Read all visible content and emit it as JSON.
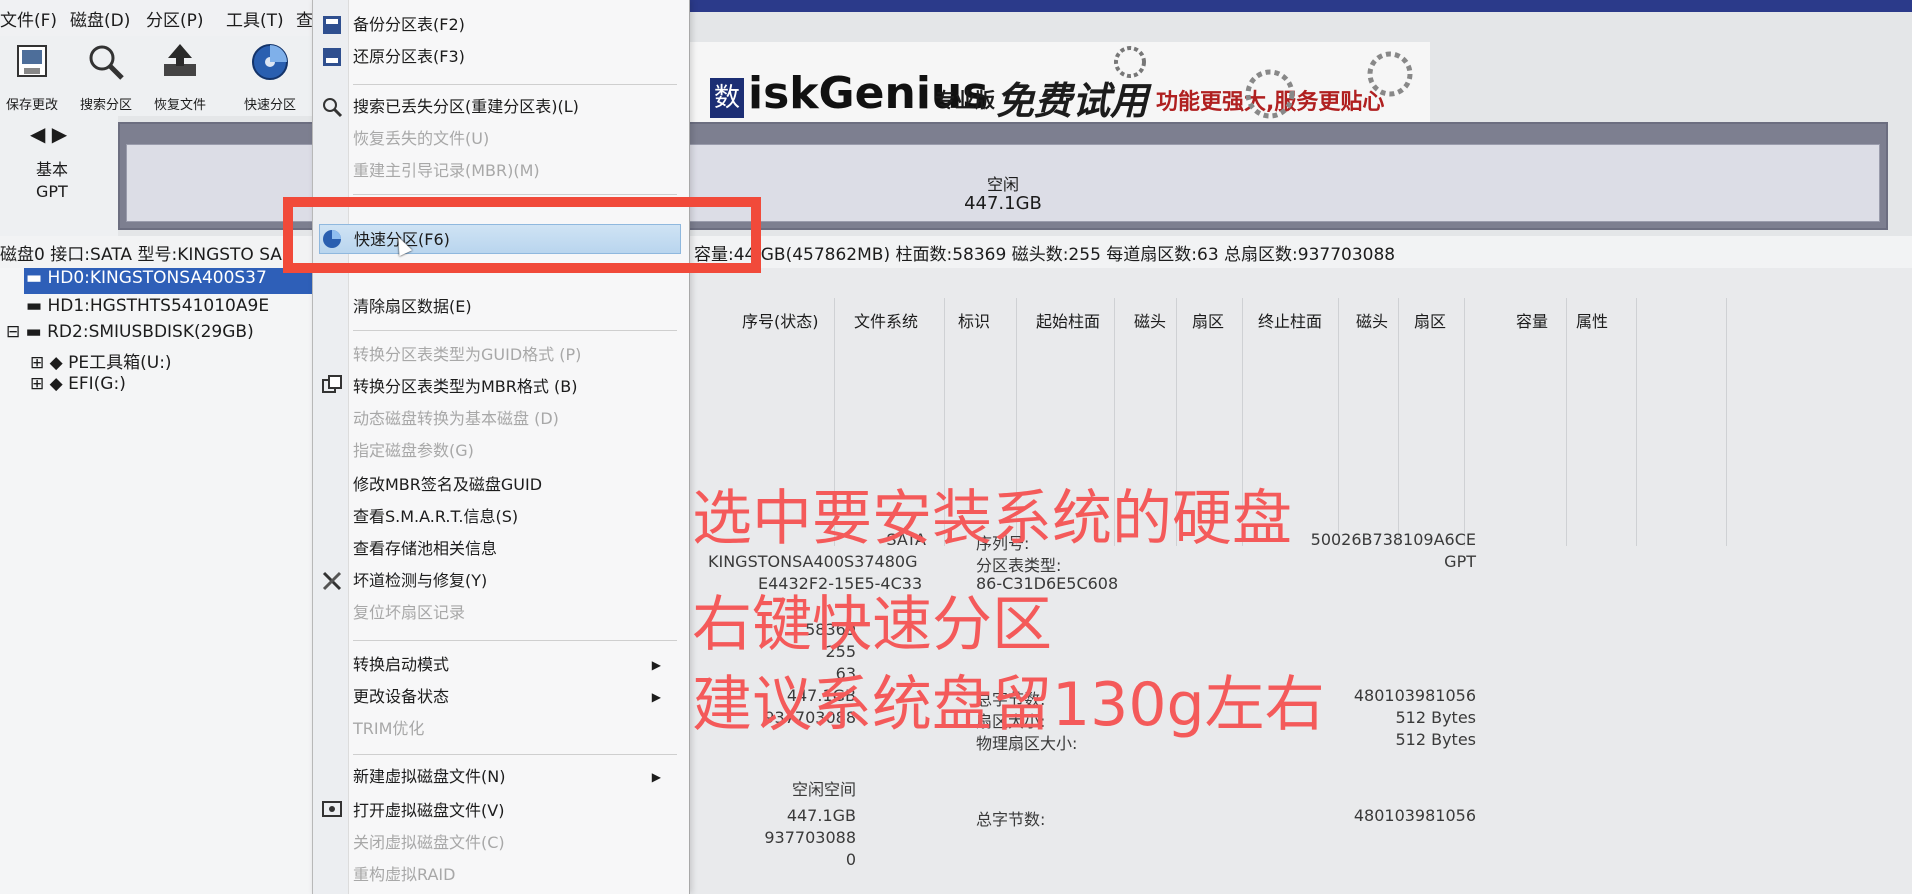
{
  "menubar": {
    "items": [
      "文件(F)",
      "磁盘(D)",
      "分区(P)",
      "工具(T)",
      "查"
    ]
  },
  "toolbar": {
    "buttons": [
      {
        "label": "保存更改",
        "icon": "save-icon"
      },
      {
        "label": "搜索分区",
        "icon": "magnifier-icon"
      },
      {
        "label": "恢复文件",
        "icon": "recover-icon"
      },
      {
        "label": "快速分区",
        "icon": "disk-icon"
      }
    ]
  },
  "banner": {
    "logo_char": "数",
    "brand": "iskGenius",
    "edition": "专业版",
    "slogan1": "免费试用",
    "slogan2": "功能更强大,服务更贴心"
  },
  "disk_nav": {
    "type": "基本",
    "scheme": "GPT"
  },
  "disk_bar": {
    "label": "空闲",
    "size": "447.1GB"
  },
  "info_line": {
    "left": "磁盘0 接口:SATA  型号:KINGSTO SA",
    "right": "容量:44 GB(457862MB)  柱面数:58369  磁头数:255  每道扇区数:63  总扇区数:937703088"
  },
  "tree": [
    {
      "label": "HD0:KINGSTONSA400S37",
      "selected": true
    },
    {
      "label": "HD1:HGSTHTS541010A9E"
    },
    {
      "label": "RD2:SMIUSBDISK(29GB)"
    },
    {
      "label": "PE工具箱(U:)"
    },
    {
      "label": "EFI(G:)"
    }
  ],
  "table_headers": [
    "序号(状态)",
    "文件系统",
    "标识",
    "起始柱面",
    "磁头",
    "扇区",
    "终止柱面",
    "磁头",
    "扇区",
    "容量",
    "属性"
  ],
  "details": {
    "sata": "SATA",
    "model": "KINGSTONSA400S37480G",
    "serial_label": "序列号:",
    "part_table_label": "分区表类型:",
    "guid_frag": "E4432F2-15E5-4C33",
    "guid_frag2": "86-C31D6E5C608",
    "serial_val": "50026B738109A6CE",
    "gpt": "GPT",
    "cylinders": "58369",
    "heads": "255",
    "sectors_frag": "63",
    "cap": "447.1GB",
    "total_bytes_label": "总字节数:",
    "total_sectors": "937703088",
    "sector_size_label": "扇区大小:",
    "phys_sector_label": "物理扇区大小:",
    "bytes_val": "480103981056",
    "sector_size": "512 Bytes",
    "phys_sector_size": "512 Bytes",
    "free_space": "空闲空间",
    "free_cap": "447.1GB",
    "free_sectors": "937703088",
    "free_start": "0",
    "free_total_label": "总字节数:",
    "free_total_val": "480103981056"
  },
  "context_menu": {
    "items": [
      {
        "label": "备份分区表(F2)",
        "state": "normal"
      },
      {
        "label": "还原分区表(F3)",
        "state": "normal"
      },
      {
        "label": "搜索已丢失分区(重建分区表)(L)",
        "state": "normal"
      },
      {
        "label": "恢复丢失的文件(U)",
        "state": "disabled"
      },
      {
        "label": "重建主引导记录(MBR)(M)",
        "state": "disabled"
      },
      {
        "label": "快速分区(F6)",
        "state": "highlight"
      },
      {
        "label": "清除扇区数据(E)",
        "state": "normal"
      },
      {
        "label": "转换分区表类型为GUID格式 (P)",
        "state": "disabled"
      },
      {
        "label": "转换分区表类型为MBR格式 (B)",
        "state": "normal"
      },
      {
        "label": "动态磁盘转换为基本磁盘 (D)",
        "state": "disabled"
      },
      {
        "label": "指定磁盘参数(G)",
        "state": "disabled"
      },
      {
        "label": "修改MBR签名及磁盘GUID",
        "state": "normal"
      },
      {
        "label": "查看S.M.A.R.T.信息(S)",
        "state": "normal"
      },
      {
        "label": "查看存储池相关信息",
        "state": "normal"
      },
      {
        "label": "坏道检测与修复(Y)",
        "state": "normal"
      },
      {
        "label": "复位坏扇区记录",
        "state": "disabled"
      },
      {
        "label": "转换启动模式",
        "state": "submenu"
      },
      {
        "label": "更改设备状态",
        "state": "submenu"
      },
      {
        "label": "TRIM优化",
        "state": "disabled"
      },
      {
        "label": "新建虚拟磁盘文件(N)",
        "state": "submenu"
      },
      {
        "label": "打开虚拟磁盘文件(V)",
        "state": "normal"
      },
      {
        "label": "关闭虚拟磁盘文件(C)",
        "state": "disabled"
      },
      {
        "label": "重构虚拟RAID",
        "state": "disabled"
      }
    ]
  },
  "annotation": {
    "line1": "选中要安装系统的硬盘",
    "line2": "右键快速分区",
    "line3": "建议系统盘留130g左右"
  },
  "colors": {
    "annotation": "#f45a5a",
    "highlight_box": "#f14a3a",
    "selection": "#2e5fb8"
  }
}
